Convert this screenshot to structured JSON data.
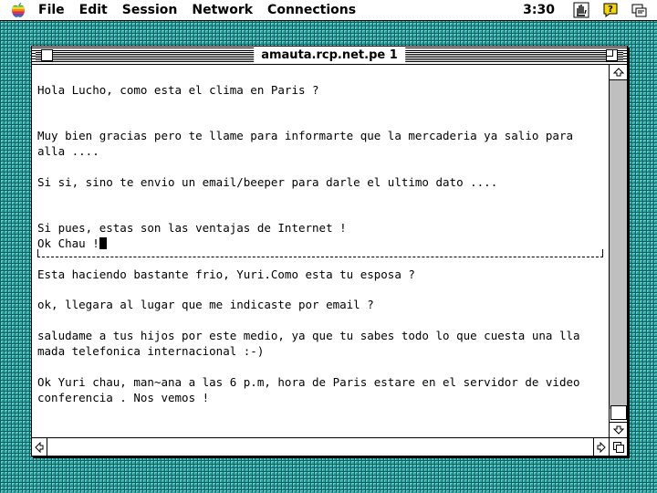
{
  "menubar": {
    "apple_icon": "apple-logo-rainbow",
    "items": [
      "File",
      "Edit",
      "Session",
      "Network",
      "Connections"
    ],
    "clock": "3:30",
    "icons": [
      "finder-hand-icon",
      "help-question-icon",
      "application-switcher-icon"
    ]
  },
  "window": {
    "title": "amauta.rcp.net.pe 1"
  },
  "terminal": {
    "lines": [
      "Hola Lucho, como esta el clima en Paris ?",
      "",
      "",
      "Muy bien gracias pero te llame para informarte que la mercaderia ya salio para",
      "alla ....",
      "",
      "Si si, sino te envio un email/beeper para darle el ultimo dato ....",
      "",
      "",
      "Si pues, estas son las ventajas de Internet !",
      "Ok Chau !",
      "Esta haciendo bastante frio, Yuri.Como esta tu esposa ?",
      "",
      "ok, llegara al lugar que me indicaste por email ?",
      "",
      "saludame a tus hijos por este medio, ya que tu sabes todo lo que cuesta una lla",
      "mada telefonica internacional :-)",
      "",
      "Ok Yuri chau, man~ana a las 6 p.m, hora de Paris estare en el servidor de video",
      "conferencia . Nos vemos !"
    ]
  },
  "colors": {
    "desktop": "#2aa3a3",
    "window_bg": "#ffffff",
    "text": "#000000"
  }
}
